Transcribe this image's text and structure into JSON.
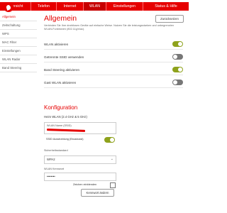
{
  "nav": {
    "items": [
      "Übersicht",
      "Telefon",
      "Internet",
      "WLAN",
      "Einstellungen",
      "Status & Hilfe"
    ],
    "active": "WLAN"
  },
  "sidebar": {
    "items": [
      {
        "label": "Allgemein",
        "active": true
      },
      {
        "label": "Zeitschaltung"
      },
      {
        "label": "WPS"
      },
      {
        "label": "MAC Filter"
      },
      {
        "label": "Einstellungen"
      },
      {
        "label": "WLAN Radar"
      },
      {
        "label": "Band Steering"
      }
    ]
  },
  "main": {
    "title": "Allgemein",
    "reset_label": "Zurücksetzen",
    "intro": "Verbinden Sie Ihre drahtlosen Geräte auf einfache Weise. Nutzen Sie die leistungsstarken und unbegrenzten WLAN-Funktionen (802.11g/n/ac).",
    "toggles": [
      {
        "label": "WLAN aktivieren",
        "state": "on"
      },
      {
        "label": "Getrennte SSID verwenden",
        "state": "off"
      },
      {
        "label": "Band Steering aktivieren",
        "state": "on"
      },
      {
        "label": "Gast WLAN aktivieren",
        "state": "off"
      }
    ]
  },
  "config": {
    "title": "Konfiguration",
    "subhead": "Heim WLAN (2.4 GHz & 5 GHz)",
    "name_label": "WLAN Name (SSID)",
    "ssid_broadcast_label": "SSID Ausstrahlung (Broadcast)",
    "security_label": "Sicherheitsstandard",
    "security_value": "WPA2",
    "password_label": "WLAN Kennwort",
    "password_value": "••••••••",
    "show_chars_label": "Zeichen einblenden",
    "change_password_label": "Kennwort ändern"
  },
  "colors": {
    "brand": "#e60000",
    "toggle_on": "#8ea21c",
    "toggle_off": "#777777"
  }
}
